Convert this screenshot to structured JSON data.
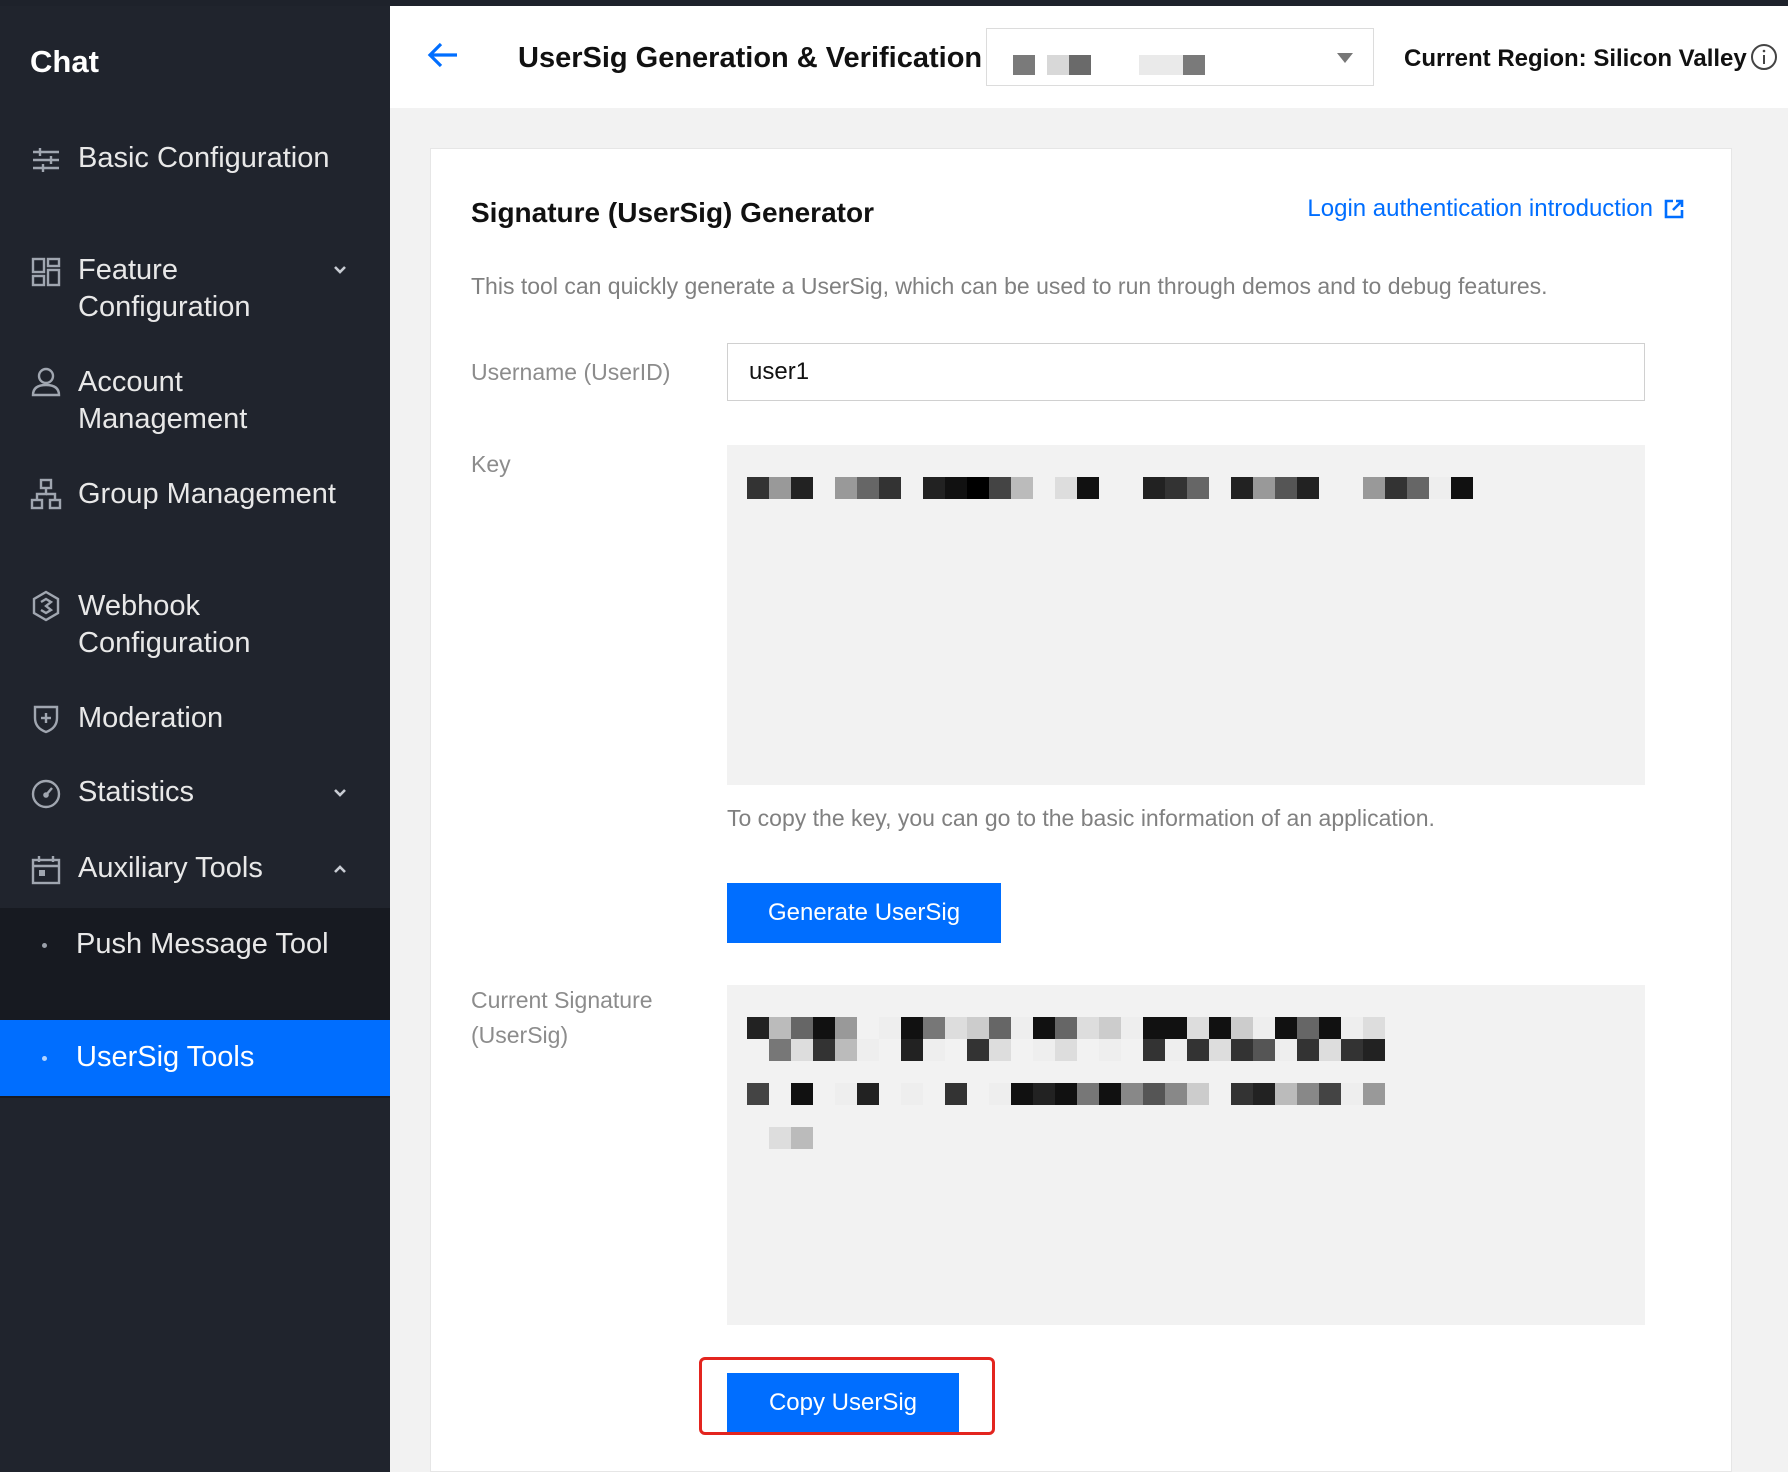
{
  "sidebar": {
    "title": "Chat",
    "items": [
      {
        "label": "Basic Configuration"
      },
      {
        "label": "Feature Configuration"
      },
      {
        "label": "Account Management"
      },
      {
        "label": "Group Management"
      },
      {
        "label": "Webhook Configuration"
      },
      {
        "label": "Moderation"
      },
      {
        "label": "Statistics"
      },
      {
        "label": "Auxiliary Tools"
      }
    ],
    "sub_items": [
      {
        "label": "Push Message Tool"
      },
      {
        "label": "UserSig Tools",
        "active": true
      }
    ]
  },
  "header": {
    "title": "UserSig Generation & Verification",
    "region_label": "Current Region: Silicon Valley"
  },
  "card": {
    "title": "Signature (UserSig) Generator",
    "doc_link": "Login authentication introduction",
    "description": "This tool can quickly generate a UserSig, which can be used to run through demos and to debug features.",
    "username_label": "Username (UserID)",
    "username_value": "user1",
    "key_label": "Key",
    "key_hint": "To copy the key, you can go to the basic information of an application.",
    "generate_button": "Generate UserSig",
    "signature_label": "Current Signature (UserSig)",
    "copy_button": "Copy UserSig"
  },
  "colors": {
    "sidebar_bg": "#20242d",
    "active_bg": "#006eff",
    "primary": "#006eff",
    "highlight": "#e3251f"
  }
}
